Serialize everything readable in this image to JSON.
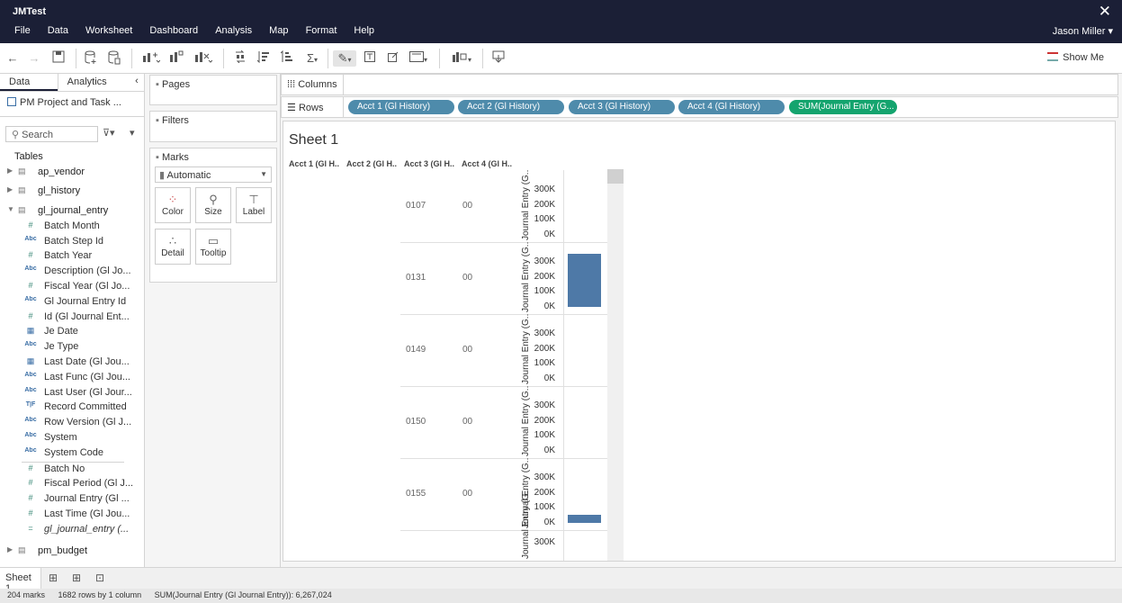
{
  "app": {
    "title": "JMTest",
    "close_glyph": "✕",
    "user": "Jason Miller ▾"
  },
  "menu": [
    "File",
    "Data",
    "Worksheet",
    "Dashboard",
    "Analysis",
    "Map",
    "Format",
    "Help"
  ],
  "toolbar": {
    "show_me": "Show Me"
  },
  "left_panel": {
    "tabs": [
      "Data",
      "Analytics"
    ],
    "datasource": "PM Project and Task ...",
    "search_placeholder": "Search",
    "tables_header": "Tables",
    "tables": [
      "ap_vendor",
      "gl_history",
      "gl_journal_entry",
      "pm_budget"
    ],
    "fields_dimensions": [
      {
        "type": "#",
        "name": "Batch Month"
      },
      {
        "type": "Abc",
        "name": "Batch Step Id"
      },
      {
        "type": "#",
        "name": "Batch Year"
      },
      {
        "type": "Abc",
        "name": "Description (Gl Jo..."
      },
      {
        "type": "#",
        "name": "Fiscal Year (Gl Jo..."
      },
      {
        "type": "Abc",
        "name": "Gl Journal Entry Id"
      },
      {
        "type": "#",
        "name": "Id (Gl Journal Ent..."
      },
      {
        "type": "date",
        "name": "Je Date"
      },
      {
        "type": "Abc",
        "name": "Je Type"
      },
      {
        "type": "date",
        "name": "Last Date (Gl Jou..."
      },
      {
        "type": "Abc",
        "name": "Last Func (Gl Jou..."
      },
      {
        "type": "Abc",
        "name": "Last User (Gl Jour..."
      },
      {
        "type": "T|F",
        "name": "Record Committed"
      },
      {
        "type": "Abc",
        "name": "Row Version (Gl J..."
      },
      {
        "type": "Abc",
        "name": "System"
      },
      {
        "type": "Abc",
        "name": "System Code"
      }
    ],
    "fields_measures": [
      {
        "type": "#",
        "name": "Batch No"
      },
      {
        "type": "#",
        "name": "Fiscal Period (Gl J..."
      },
      {
        "type": "#",
        "name": "Journal Entry (Gl ..."
      },
      {
        "type": "#",
        "name": "Last Time (Gl Jou..."
      },
      {
        "type": "=",
        "name": "gl_journal_entry (..."
      }
    ]
  },
  "shelves": {
    "pages": "Pages",
    "filters": "Filters",
    "marks": "Marks",
    "mark_type": "Automatic",
    "mark_buttons": [
      "Color",
      "Size",
      "Label",
      "Detail",
      "Tooltip"
    ],
    "columns": "Columns",
    "rows": "Rows",
    "row_pills": [
      "Acct 1 (Gl History)",
      "Acct 2 (Gl History)",
      "Acct 3 (Gl History)",
      "Acct 4 (Gl History)",
      "SUM(Journal Entry (G..."
    ]
  },
  "sheet": {
    "title": "Sheet 1",
    "col_headers": [
      "Acct 1 (Gl H..",
      "Acct 2 (Gl H..",
      "Acct 3 (Gl H..",
      "Acct 4 (Gl H.."
    ]
  },
  "chart_data": {
    "type": "bar",
    "ylabel": "Journal Entry (G..",
    "ylim": [
      0,
      350000
    ],
    "ticks": [
      "300K",
      "200K",
      "100K",
      "0K"
    ],
    "rows": [
      {
        "acct3": "0107",
        "acct4": "00",
        "value": 0
      },
      {
        "acct3": "0131",
        "acct4": "00",
        "value": 355000
      },
      {
        "acct3": "0149",
        "acct4": "00",
        "value": 0
      },
      {
        "acct3": "0150",
        "acct4": "00",
        "value": 0
      },
      {
        "acct3": "0155",
        "acct4": "00",
        "value": 55000
      }
    ]
  },
  "sheet_tabs": [
    "Sheet 1"
  ],
  "status": [
    "204 marks",
    "1682 rows by 1 column",
    "SUM(Journal Entry (Gl Journal Entry)): 6,267,024"
  ]
}
